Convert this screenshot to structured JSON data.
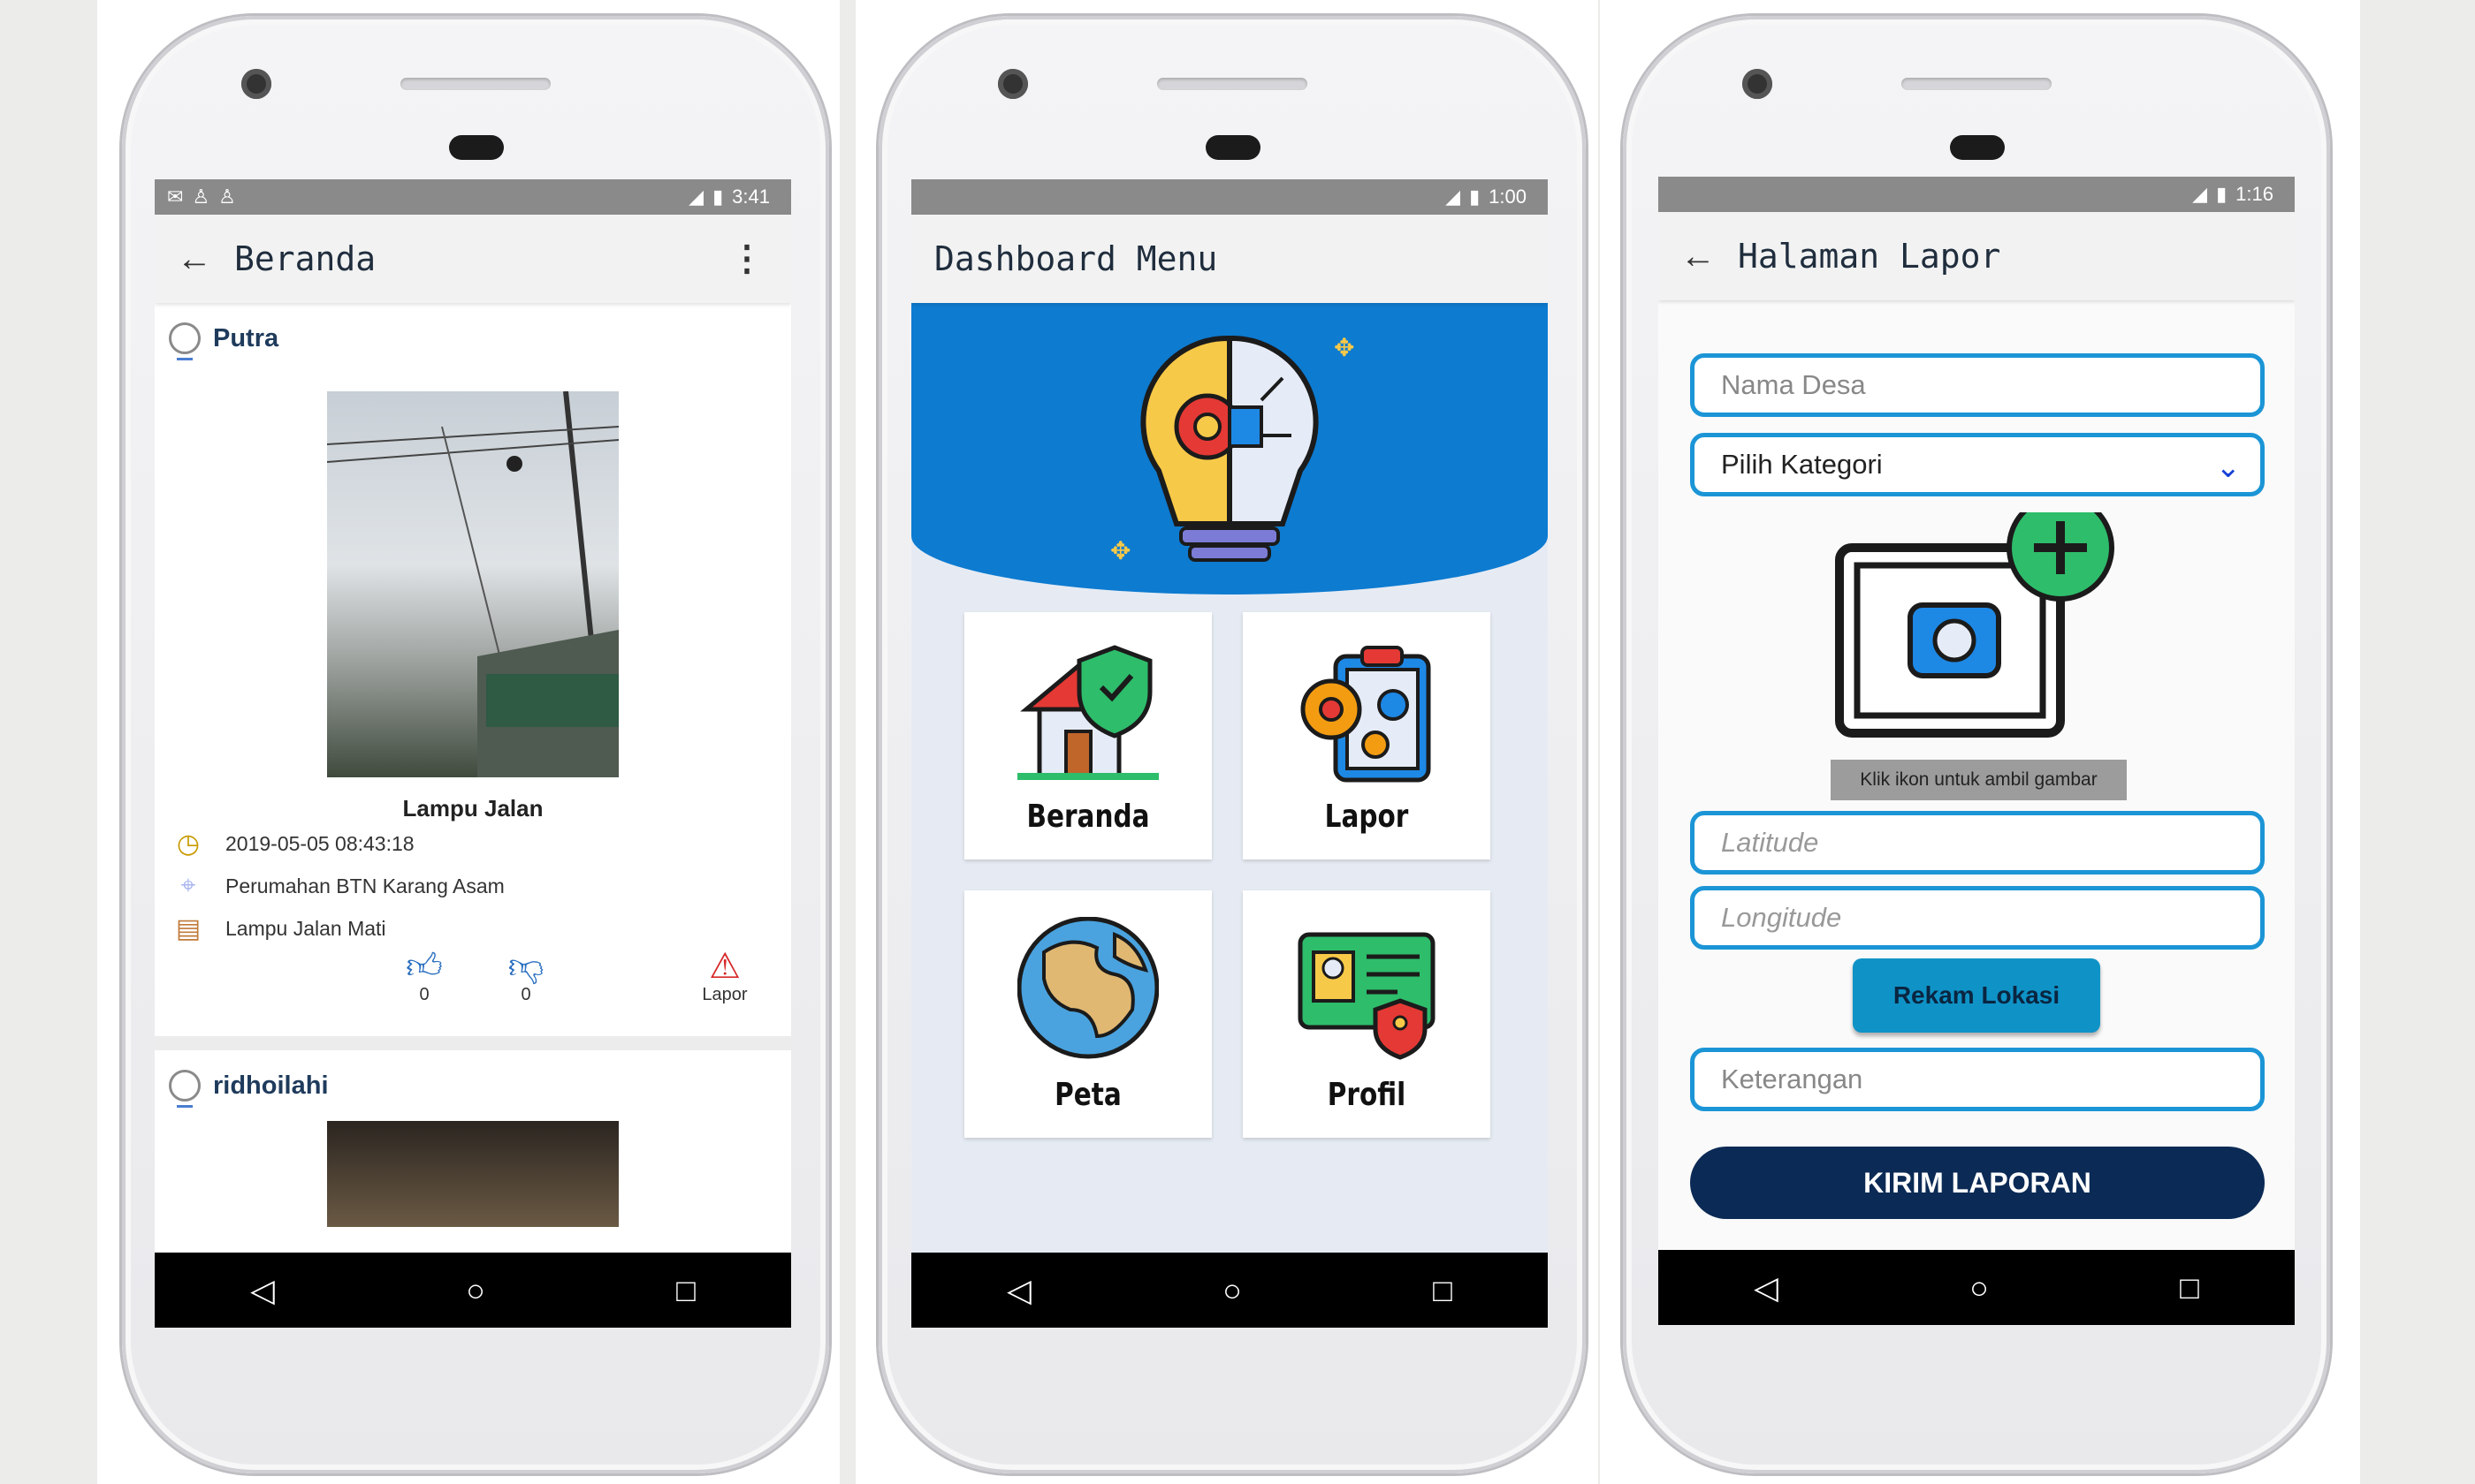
{
  "screen1": {
    "status": {
      "time": "3:41",
      "left_icons": [
        "mail-icon",
        "person-icon",
        "person-icon"
      ]
    },
    "title": "Beranda",
    "back_glyph": "←",
    "menu_glyph": "⋮",
    "post1": {
      "user": "Putra",
      "caption": "Lampu Jalan",
      "datetime": "2019-05-05 08:43:18",
      "location": "Perumahan BTN Karang Asam",
      "category": "Lampu Jalan Mati",
      "likes": "0",
      "dislikes": "0",
      "report_label": "Lapor"
    },
    "post2": {
      "user": "ridhoilahi"
    }
  },
  "screen2": {
    "status": {
      "time": "1:00"
    },
    "title": "Dashboard Menu",
    "tiles": [
      "Beranda",
      "Lapor",
      "Peta",
      "Profil"
    ]
  },
  "screen3": {
    "status": {
      "time": "1:16"
    },
    "title": "Halaman Lapor",
    "back_glyph": "←",
    "nama_desa_placeholder": "Nama Desa",
    "kategori_value": "Pilih Kategori",
    "image_hint": "Klik ikon untuk ambil gambar",
    "latitude_placeholder": "Latitude",
    "longitude_placeholder": "Longitude",
    "rekam_label": "Rekam Lokasi",
    "keterangan_placeholder": "Keterangan",
    "kirim_label": "KIRIM LAPORAN"
  },
  "nav": {
    "back": "◁",
    "home": "○",
    "recent": "□"
  },
  "colors": {
    "accent": "#1b95d6",
    "primary_dark": "#0b2a55",
    "banner": "#0d7bd0",
    "add_green": "#2ebd6b"
  }
}
